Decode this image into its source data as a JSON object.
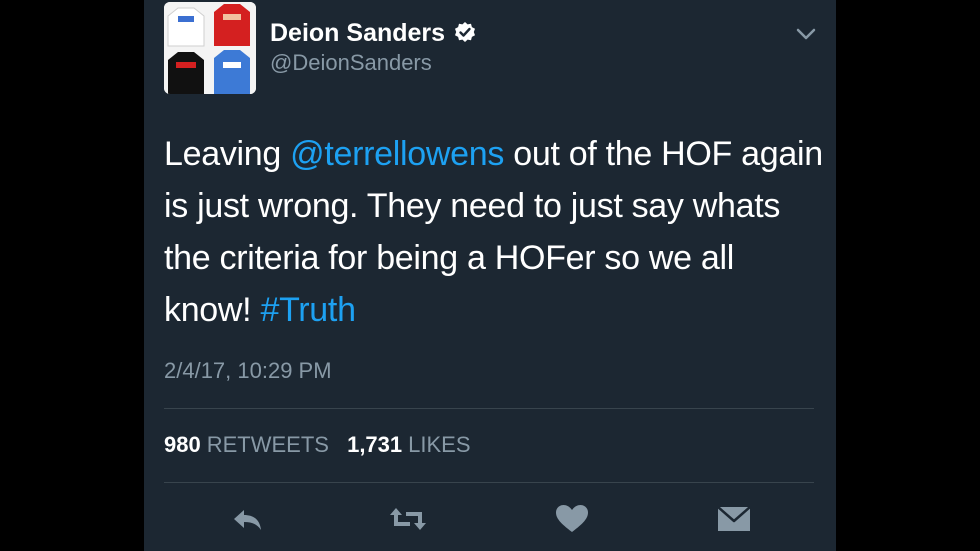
{
  "user": {
    "display_name": "Deion Sanders",
    "handle": "@DeionSanders",
    "verified": true
  },
  "tweet": {
    "text_parts": [
      {
        "text": "Leaving ",
        "type": "text"
      },
      {
        "text": "@terrellowens",
        "type": "mention"
      },
      {
        "text": " out of the HOF again is just wrong. They need to just say whats the criteria for being a HOFer so we all know! ",
        "type": "text"
      },
      {
        "text": "#Truth",
        "type": "hashtag"
      }
    ],
    "timestamp": "2/4/17, 10:29 PM"
  },
  "stats": {
    "retweets_count": "980",
    "retweets_label": "RETWEETS",
    "likes_count": "1,731",
    "likes_label": "LIKES"
  },
  "actions": [
    "reply-icon",
    "retweet-icon",
    "like-icon",
    "message-icon"
  ],
  "colors": {
    "background": "#1c2732",
    "link": "#1da1f2",
    "muted": "#8899a6",
    "divider": "#38444d"
  }
}
